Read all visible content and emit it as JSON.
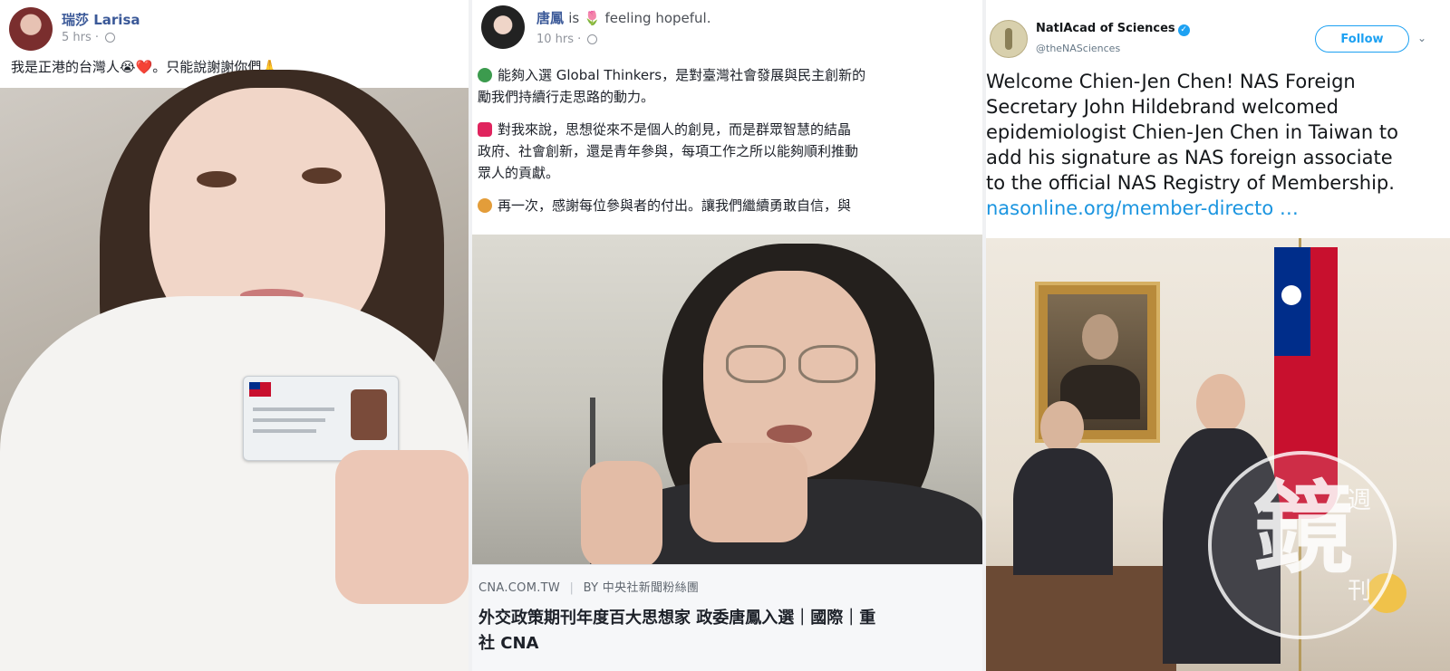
{
  "post1": {
    "author": "瑞莎 Larisa",
    "time": "5 hrs",
    "text": "我是正港的台灣人😭❤️。只能說謝謝你們🙏",
    "avatar_icon": "profile-avatar",
    "photo_icon": "selfie-with-id-card"
  },
  "post2": {
    "author": "唐鳳",
    "feeling": "is 🌷 feeling hopeful.",
    "time": "10 hrs",
    "paragraphs": [
      "能夠入選 Global Thinkers，是對臺灣社會發展與民主創新的",
      "勵我們持續行走思路的動力。",
      "對我來說，思想從來不是個人的創見，而是群眾智慧的結晶",
      "政府、社會創新，還是青年參與，每項工作之所以能夠順利推動",
      "眾人的貢獻。",
      "再一次，感謝每位參與者的付出。讓我們繼續勇敢自信，與"
    ],
    "link": {
      "domain": "CNA.COM.TW",
      "by": "BY 中央社新聞粉絲團",
      "title_line1": "外交政策期刊年度百大思想家 政委唐鳳入選｜國際｜重",
      "title_line2": "社 CNA"
    }
  },
  "post3": {
    "name": "NatlAcad of Sciences",
    "handle": "@theNASciences",
    "follow_label": "Follow",
    "lines": [
      "Welcome Chien-Jen Chen! NAS Foreign",
      "Secretary John Hildebrand welcomed",
      "epidemiologist Chien-Jen Chen in Taiwan to",
      "add his signature as NAS foreign associate",
      "to the official NAS Registry of Membership."
    ],
    "link_text": "nasonline.org/member-directo …",
    "watermark": {
      "big": "鏡",
      "small1": "週",
      "small2": "刊"
    }
  },
  "colors": {
    "fb_blue": "#3b5998",
    "tw_blue": "#1da1f2",
    "link_blue": "#1b95e0"
  }
}
